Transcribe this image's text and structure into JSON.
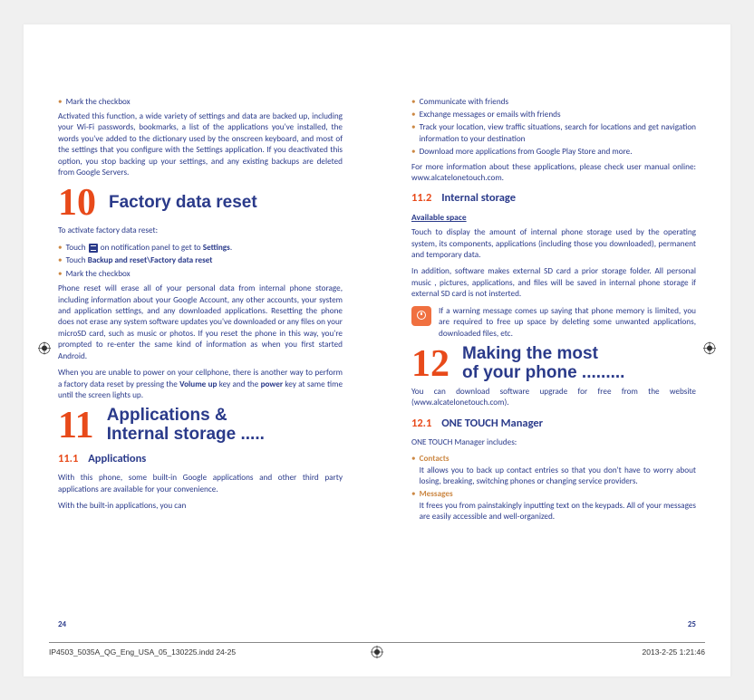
{
  "left": {
    "bullet1": "Mark the checkbox",
    "para1": "Activated this function, a wide variety of settings and data are backed up, including your Wi-Fi passwords, bookmarks, a list of the applications you've installed, the words you've added to the dictionary used by the onscreen keyboard, and most of the settings that you configure with the Settings application. If you deactivated this option, you stop backing up your settings, and any existing backups are deleted from Google Servers.",
    "ch10_num": "10",
    "ch10_title": "Factory data reset",
    "activate": "To activate factory data reset:",
    "b10_1a": "Touch ",
    "b10_1b": " on notification panel to get to ",
    "b10_1c": "Settings",
    "b10_1d": ".",
    "b10_2a": "Touch ",
    "b10_2b": "Backup and reset\\Factory data reset",
    "b10_3": "Mark the checkbox",
    "para2": "Phone reset will erase all of your personal data from internal phone storage, including information about your Google Account, any other accounts, your system and application settings, and any downloaded applications. Resetting the phone does not erase any system software updates you've downloaded or any files on your microSD card, such as music or photos. If you reset the phone in this way, you're prompted to re-enter the same kind of information as when you first started Android.",
    "para3a": "When you are unable to power on your cellphone, there is another way to perform a factory data reset by pressing the ",
    "para3b": "Volume up",
    "para3c": " key and the ",
    "para3d": "power",
    "para3e": " key at same time until the screen lights up.",
    "ch11_num": "11",
    "ch11_title1": "Applications &",
    "ch11_title2": "Internal storage .....",
    "s111_num": "11.1",
    "s111_title": "Applications",
    "para4": "With this phone, some built-in Google applications and other third party applications are available for your convenience.",
    "para5": "With the built-in applications, you can",
    "page_num": "24"
  },
  "right": {
    "b1": "Communicate with friends",
    "b2": "Exchange messages or emails with friends",
    "b3": "Track your location, view traffic situations, search for locations and get navigation information to your destination",
    "b4": "Download more applications from Google Play Store and more.",
    "para1": "For more information about these applications, please check user manual  online: www.alcatelonetouch.com.",
    "s112_num": "11.2",
    "s112_title": "Internal storage",
    "avail": "Available space",
    "para2": "Touch to display the amount of internal phone storage used by the operating system, its components, applications (including those you downloaded), permanent and temporary data.",
    "para3": "In addition, software makes external SD card  a prior storage folder. All personal music , pictures, applications, and files will be saved in internal phone storage if external SD card is not insterted.",
    "warn": "If a warning message comes up saying that phone memory is limited, you are required to free up space by deleting some unwanted applications, downloaded files, etc.",
    "ch12_num": "12",
    "ch12_title1": "Making the most",
    "ch12_title2": "of your phone .........",
    "para4": "You can download software upgrade for free from the website (www.alcatelonetouch.com).",
    "s121_num": "12.1",
    "s121_title": "ONE TOUCH Manager",
    "para5": "ONE TOUCH Manager includes:",
    "contacts_h": "Contacts",
    "contacts_t": "It allows you to back up contact entries so that you don't have to worry about losing, breaking, switching phones or changing service providers.",
    "messages_h": "Messages",
    "messages_t": "It frees you from painstakingly inputting text on the keypads. All of your messages are easily accessible and well-organized.",
    "page_num": "25"
  },
  "footer": {
    "file": "IP4503_5035A_QG_Eng_USA_05_130225.indd   24-25",
    "date": "2013-2-25     1:21:46"
  }
}
